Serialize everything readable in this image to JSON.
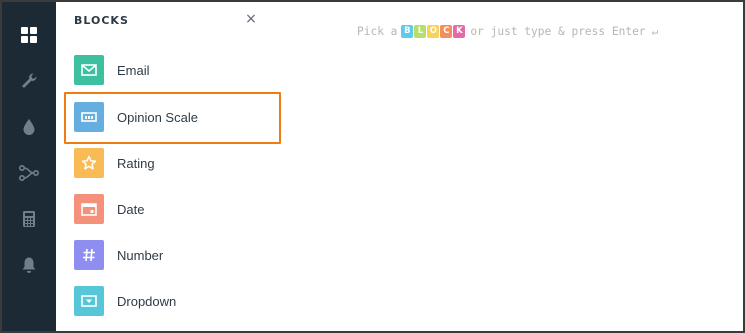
{
  "toolbar": {
    "items": [
      {
        "icon": "blocks-grid-icon",
        "active": true
      },
      {
        "icon": "wrench-icon",
        "active": false
      },
      {
        "icon": "drop-icon",
        "active": false
      },
      {
        "icon": "logic-branch-icon",
        "active": false
      },
      {
        "icon": "calculator-icon",
        "active": false
      },
      {
        "icon": "bell-icon",
        "active": false
      }
    ]
  },
  "panel": {
    "title": "BLOCKS",
    "close_symbol": "×",
    "blocks": [
      {
        "label": "Email",
        "icon": "email-icon",
        "color": "#3cc0a0"
      },
      {
        "label": "Opinion Scale",
        "icon": "opinion-scale-icon",
        "color": "#64aee0"
      },
      {
        "label": "Rating",
        "icon": "star-icon",
        "color": "#f9bb55"
      },
      {
        "label": "Date",
        "icon": "calendar-icon",
        "color": "#f5907a"
      },
      {
        "label": "Number",
        "icon": "hash-icon",
        "color": "#8e8ef0"
      },
      {
        "label": "Dropdown",
        "icon": "dropdown-icon",
        "color": "#56c7d9"
      }
    ],
    "selected": "Opinion Scale",
    "highlight_color": "#ee7d10"
  },
  "hint": {
    "prefix": "Pick a",
    "badge_letters": [
      {
        "char": "B",
        "color": "#5fcbe9"
      },
      {
        "char": "L",
        "color": "#b6df6a"
      },
      {
        "char": "O",
        "color": "#f7d35a"
      },
      {
        "char": "C",
        "color": "#f58e5e"
      },
      {
        "char": "K",
        "color": "#e66aa7"
      }
    ],
    "suffix": "or just type & press Enter",
    "enter_symbol": "↵"
  }
}
